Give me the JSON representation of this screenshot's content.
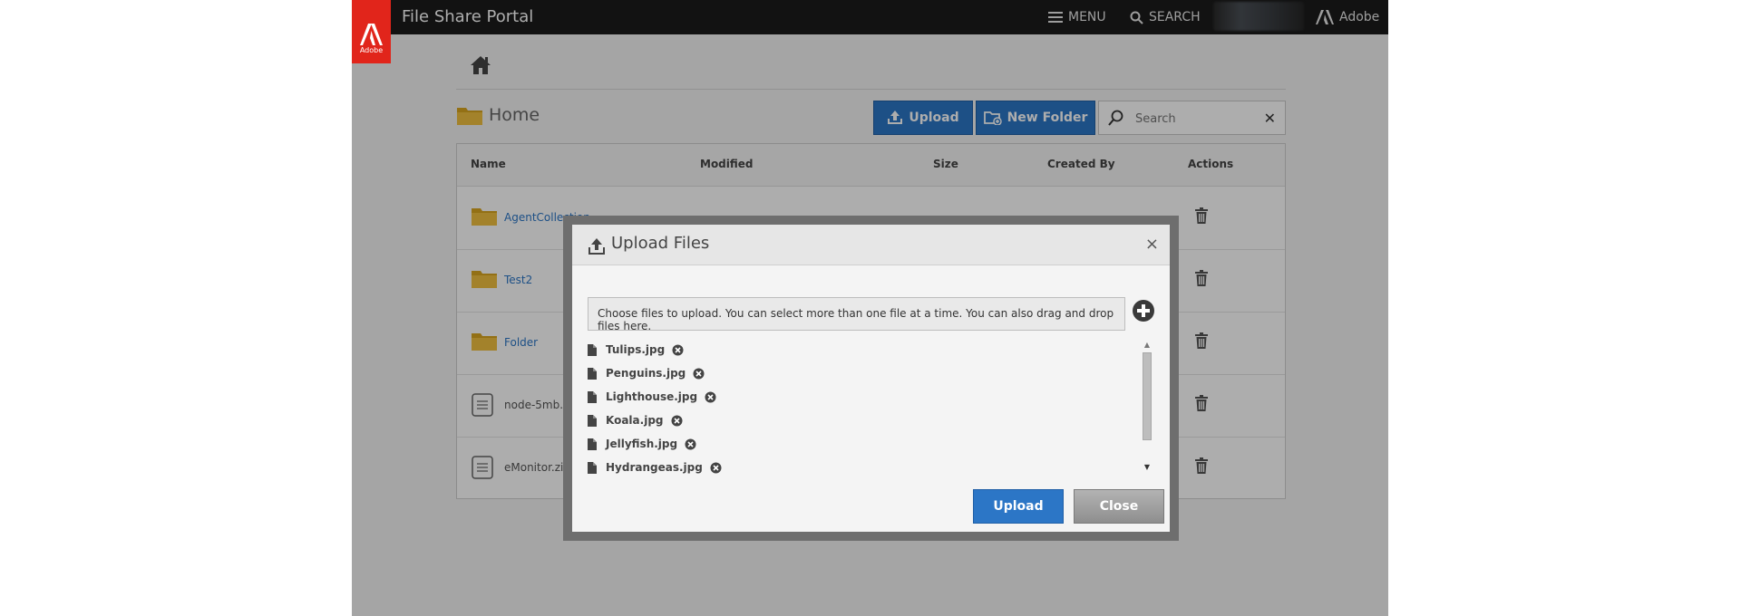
{
  "header": {
    "brand_tab": "Adobe",
    "title": "File Share Portal",
    "menu_label": "MENU",
    "search_label": "SEARCH",
    "adobe_label": "Adobe"
  },
  "breadcrumb": {
    "label": "Home"
  },
  "toolbar": {
    "upload_label": "Upload",
    "new_folder_label": "New Folder",
    "search_placeholder": "Search"
  },
  "table": {
    "columns": [
      "Name",
      "Modified",
      "Size",
      "Created By",
      "Actions"
    ],
    "rows": [
      {
        "name": "AgentCollection",
        "type": "folder"
      },
      {
        "name": "Test2",
        "type": "folder"
      },
      {
        "name": "Folder",
        "type": "folder"
      },
      {
        "name": "node-5mb.zip",
        "type": "file"
      },
      {
        "name": "eMonitor.zip",
        "type": "file"
      }
    ]
  },
  "modal": {
    "title": "Upload Files",
    "close_glyph": "×",
    "dropzone_text": "Choose files to upload. You can select more than one file at a time. You can also drag and drop files here.",
    "files": [
      "Tulips.jpg",
      "Penguins.jpg",
      "Lighthouse.jpg",
      "Koala.jpg",
      "Jellyfish.jpg",
      "Hydrangeas.jpg"
    ],
    "upload_label": "Upload",
    "close_label": "Close"
  },
  "colors": {
    "accent_blue": "#2c76c6",
    "brand_red": "#e1251b",
    "topbar": "#1b1b1b"
  },
  "icons": [
    "adobe-logo-icon",
    "menu-icon",
    "search-icon",
    "home-icon",
    "folder-icon",
    "upload-icon",
    "new-folder-icon",
    "clear-icon",
    "file-icon",
    "trash-icon",
    "add-circle-icon",
    "remove-circle-icon"
  ]
}
